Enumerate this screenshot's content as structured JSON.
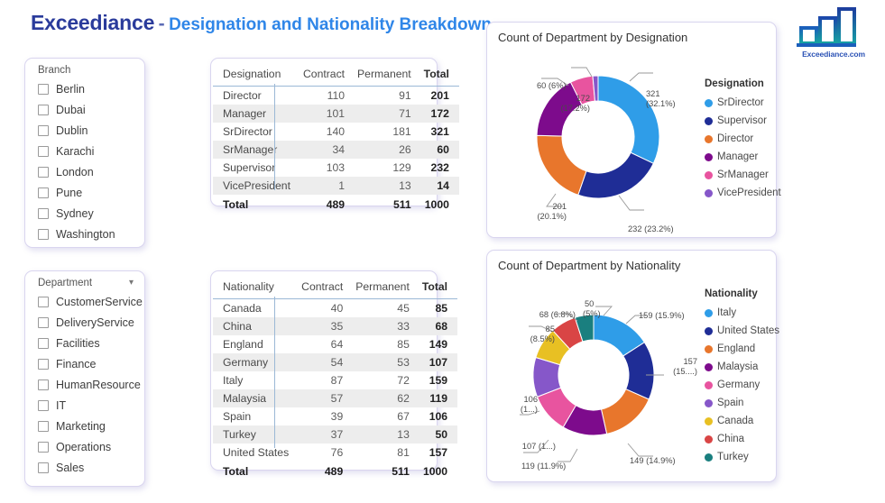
{
  "header": {
    "brand": "Exceediance",
    "separator": "-",
    "subtitle": "Designation and Nationality Breakdown"
  },
  "logo": {
    "name": "bar-chart-logo",
    "caption": "Exceediance.com",
    "colors": [
      "#1a9ea0",
      "#1b6fbe",
      "#1d3f9e"
    ]
  },
  "slicers": [
    {
      "name": "branch",
      "label": "Branch",
      "has_chevron": false,
      "items": [
        "Berlin",
        "Dubai",
        "Dublin",
        "Karachi",
        "London",
        "Pune",
        "Sydney",
        "Washington"
      ],
      "checked": []
    },
    {
      "name": "department",
      "label": "Department",
      "has_chevron": true,
      "items": [
        "CustomerService",
        "DeliveryService",
        "Facilities",
        "Finance",
        "HumanResource",
        "IT",
        "Marketing",
        "Operations",
        "Sales"
      ],
      "checked": []
    }
  ],
  "tables": [
    {
      "name": "designation-table",
      "columns": [
        "Designation",
        "Contract",
        "Permanent",
        "Total"
      ],
      "rows": [
        [
          "Director",
          "110",
          "91",
          "201"
        ],
        [
          "Manager",
          "101",
          "71",
          "172"
        ],
        [
          "SrDirector",
          "140",
          "181",
          "321"
        ],
        [
          "SrManager",
          "34",
          "26",
          "60"
        ],
        [
          "Supervisor",
          "103",
          "129",
          "232"
        ],
        [
          "VicePresident",
          "1",
          "13",
          "14"
        ]
      ],
      "total_row": [
        "Total",
        "489",
        "511",
        "1000"
      ]
    },
    {
      "name": "nationality-table",
      "columns": [
        "Nationality",
        "Contract",
        "Permanent",
        "Total"
      ],
      "rows": [
        [
          "Canada",
          "40",
          "45",
          "85"
        ],
        [
          "China",
          "35",
          "33",
          "68"
        ],
        [
          "England",
          "64",
          "85",
          "149"
        ],
        [
          "Germany",
          "54",
          "53",
          "107"
        ],
        [
          "Italy",
          "87",
          "72",
          "159"
        ],
        [
          "Malaysia",
          "57",
          "62",
          "119"
        ],
        [
          "Spain",
          "39",
          "67",
          "106"
        ],
        [
          "Turkey",
          "37",
          "13",
          "50"
        ],
        [
          "United States",
          "76",
          "81",
          "157"
        ]
      ],
      "total_row": [
        "Total",
        "489",
        "511",
        "1000"
      ]
    }
  ],
  "chart_data": [
    {
      "type": "pie",
      "name": "designation-donut",
      "title": "Count of Department by Designation",
      "legend_title": "Designation",
      "legend_position": "right",
      "total": 1000,
      "categories": [
        "SrDirector",
        "Supervisor",
        "Director",
        "Manager",
        "SrManager",
        "VicePresident"
      ],
      "values": [
        321,
        232,
        201,
        172,
        60,
        14
      ],
      "percents": [
        "32.1%",
        "23.2%",
        "20.1%",
        "17.2%",
        "6%",
        "1.4%"
      ],
      "colors": [
        "#2f9de8",
        "#1f2d96",
        "#e8762c",
        "#7d0b8c",
        "#e8549f",
        "#8657c9"
      ],
      "data_labels": [
        {
          "value": "321",
          "percent": "(32.1%)"
        },
        {
          "value": "232 (23.2%)",
          "percent": ""
        },
        {
          "value": "201",
          "percent": "(20.1%)"
        },
        {
          "value": "172",
          "percent": "(17.2%)"
        },
        {
          "value": "60 (6%)",
          "percent": ""
        }
      ]
    },
    {
      "type": "pie",
      "name": "nationality-donut",
      "title": "Count of Department by Nationality",
      "legend_title": "Nationality",
      "legend_position": "right",
      "total": 1000,
      "categories": [
        "Italy",
        "United States",
        "England",
        "Malaysia",
        "Germany",
        "Spain",
        "Canada",
        "China",
        "Turkey"
      ],
      "values": [
        159,
        157,
        149,
        119,
        107,
        106,
        85,
        68,
        50
      ],
      "percents": [
        "15.9%",
        "15.7%",
        "14.9%",
        "11.9%",
        "10.7%",
        "10.6%",
        "8.5%",
        "6.8%",
        "5%"
      ],
      "colors": [
        "#2f9de8",
        "#1f2d96",
        "#e8762c",
        "#7d0b8c",
        "#e8549f",
        "#8657c9",
        "#e8c023",
        "#d94545",
        "#1a7f7f"
      ],
      "data_labels": [
        {
          "value": "159 (15.9%)",
          "percent": ""
        },
        {
          "value": "157",
          "percent": "(15....)"
        },
        {
          "value": "149 (14.9%)",
          "percent": ""
        },
        {
          "value": "119 (11.9%)",
          "percent": ""
        },
        {
          "value": "107 (1...)",
          "percent": ""
        },
        {
          "value": "106",
          "percent": "(1...)"
        },
        {
          "value": "85",
          "percent": "(8.5%)"
        },
        {
          "value": "68 (6.8%)",
          "percent": ""
        },
        {
          "value": "50",
          "percent": "(5%)"
        }
      ]
    }
  ]
}
